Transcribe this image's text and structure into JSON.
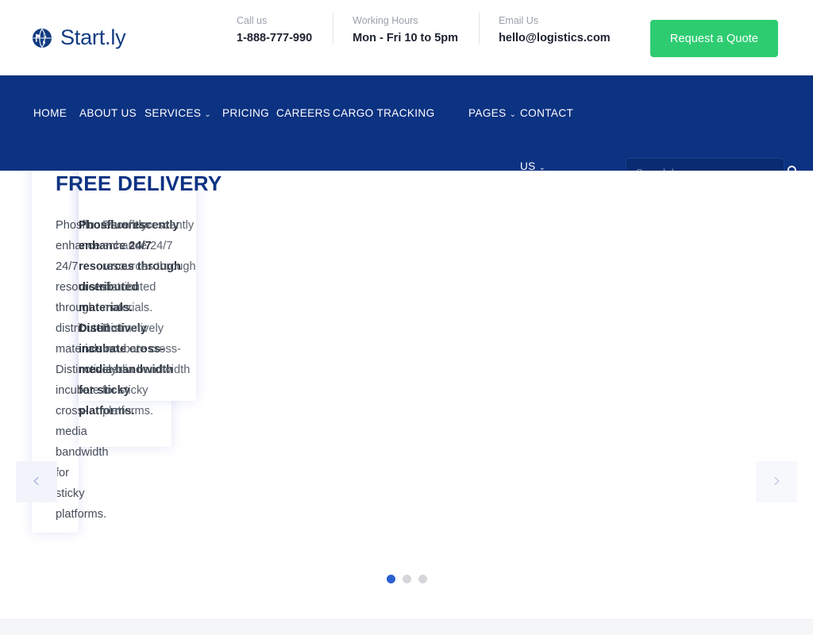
{
  "brand": {
    "name": "Start.ly",
    "icon": "globe-icon"
  },
  "topbar": {
    "contacts": [
      {
        "label": "Call us",
        "value": "1-888-777-990"
      },
      {
        "label": "Working Hours",
        "value": "Mon - Fri 10 to 5pm"
      },
      {
        "label": "Email Us",
        "value": "hello@logistics.com"
      }
    ],
    "quote_button": "Request a Quote"
  },
  "nav": {
    "items": [
      {
        "label": "HOME",
        "has_dropdown": false
      },
      {
        "label": "ABOUT US",
        "has_dropdown": false
      },
      {
        "label": "SERVICES",
        "has_dropdown": true
      },
      {
        "label": "PRICING",
        "has_dropdown": false
      },
      {
        "label": "CAREERS",
        "has_dropdown": false
      },
      {
        "label": "CARGO TRACKING",
        "has_dropdown": false
      },
      {
        "label": "PAGES",
        "has_dropdown": true
      },
      {
        "label": "CONTACT US",
        "has_dropdown": true
      }
    ],
    "caret": "⌄"
  },
  "search": {
    "placeholder": "Search here...",
    "value": "",
    "icon": "search-icon"
  },
  "hero": {
    "heading": "FREE DELIVERY",
    "text_narrow": "Phosfluorescently enhance 24/7 resources through distributed materials. Distinctively incubate cross-media bandwidth for sticky platforms.",
    "text_wide": "Phosfluorescently enhance 24/7 resources through distributed materials. Distinctively incubate cross-media bandwidth for sticky platforms.",
    "text_overlay": "Phosfluorescently enhance 24/7 resources through distributed materials. Distinctively incubate cross-media bandwidth for sticky platforms.",
    "prev_label": "‹",
    "next_label": "›",
    "dots": [
      {
        "active": true
      },
      {
        "active": false
      },
      {
        "active": false
      }
    ]
  },
  "colors": {
    "navy": "#0c3282",
    "green": "#2ecc71",
    "dot_active": "#2a5fd0",
    "dot_inactive": "#d4d6da",
    "section_bg": "#f5f6f8"
  }
}
